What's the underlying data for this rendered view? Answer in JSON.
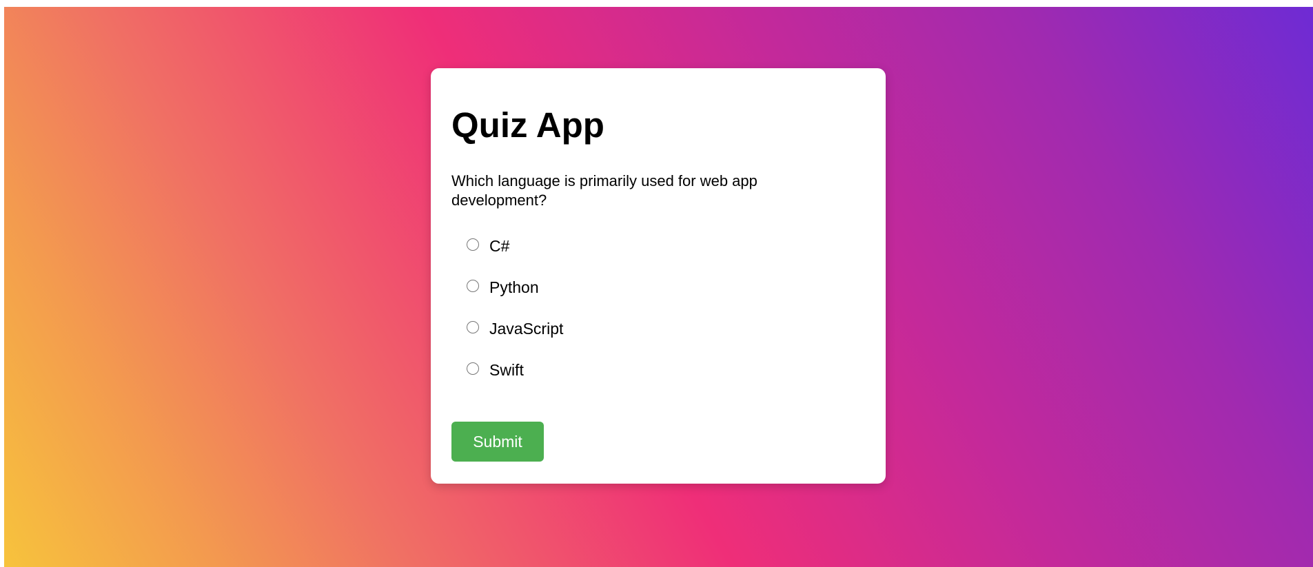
{
  "app": {
    "title": "Quiz App"
  },
  "quiz": {
    "question": "Which language is primarily used for web app development?",
    "options": [
      {
        "label": "C#",
        "selected": false
      },
      {
        "label": "Python",
        "selected": false
      },
      {
        "label": "JavaScript",
        "selected": false
      },
      {
        "label": "Swift",
        "selected": false
      }
    ],
    "submit_label": "Submit"
  },
  "colors": {
    "gradient_start": "#f7c33c",
    "gradient_mid": "#ef2e78",
    "gradient_end": "#6e2bd4",
    "submit_button": "#4caf50",
    "card_background": "#ffffff"
  },
  "icons": {
    "option_marker": "radio-button-icon"
  }
}
